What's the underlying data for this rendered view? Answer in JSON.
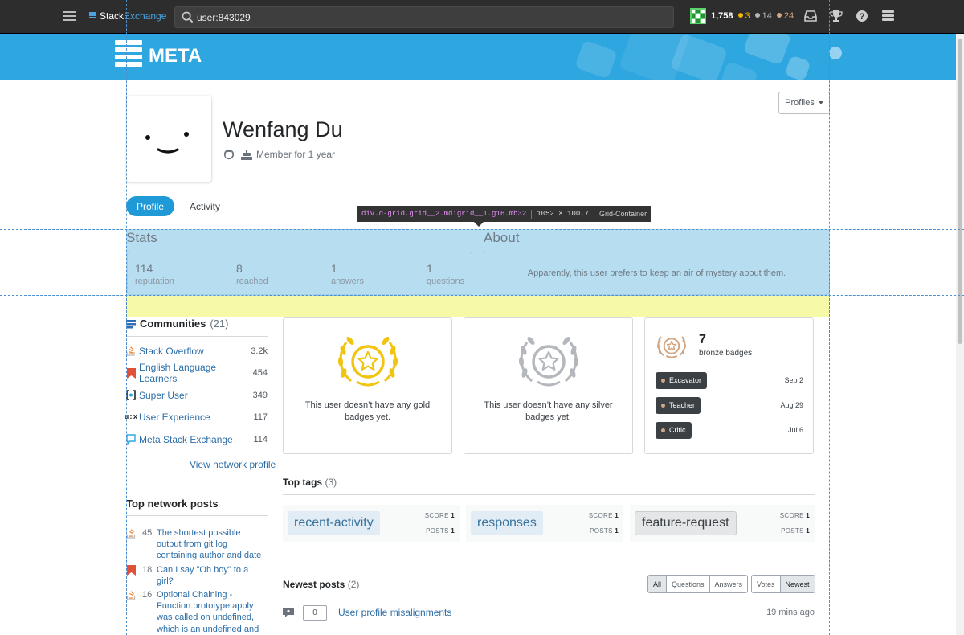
{
  "topbar": {
    "logo_primary": "Stack",
    "logo_secondary": "Exchange",
    "search_value": "user:843029",
    "reputation": "1,758",
    "gold": "3",
    "silver": "14",
    "bronze": "24"
  },
  "site": {
    "name": "META"
  },
  "devtools": {
    "selector": "div.d-grid.grid__2.md:grid__1.g16.mb32",
    "size": "1052 × 100.7",
    "kind": "Grid-Container"
  },
  "profile": {
    "name": "Wenfang Du",
    "member_for": "Member for 1 year",
    "profiles_button": "Profiles",
    "tabs": [
      {
        "label": "Profile"
      },
      {
        "label": "Activity"
      }
    ]
  },
  "stats": {
    "heading": "Stats",
    "items": [
      {
        "value": "114",
        "label": "reputation"
      },
      {
        "value": "8",
        "label": "reached"
      },
      {
        "value": "1",
        "label": "answers"
      },
      {
        "value": "1",
        "label": "questions"
      }
    ]
  },
  "about": {
    "heading": "About",
    "text": "Apparently, this user prefers to keep an air of mystery about them."
  },
  "communities": {
    "heading": "Communities",
    "count": "(21)",
    "items": [
      {
        "name": "Stack Overflow",
        "rep": "3.2k",
        "icon": "stack-overflow-icon",
        "color": "#f48024"
      },
      {
        "name": "English Language Learners",
        "rep": "454",
        "icon": "ell-icon",
        "color": "#e0513b"
      },
      {
        "name": "Super User",
        "rep": "349",
        "icon": "super-user-icon",
        "color": "#2f4d80"
      },
      {
        "name": "User Experience",
        "rep": "117",
        "icon": "ux-icon",
        "color": "#232629"
      },
      {
        "name": "Meta Stack Exchange",
        "rep": "114",
        "icon": "meta-icon",
        "color": "#2ea7e0"
      }
    ],
    "view_network": "View network profile"
  },
  "top_network_posts": {
    "heading": "Top network posts",
    "items": [
      {
        "score": "45",
        "title": "The shortest possible output from git log containing author and date"
      },
      {
        "score": "18",
        "title": "Can I say \"Oh boy\" to a girl?"
      },
      {
        "score": "16",
        "title": "Optional Chaining - Function.prototype.apply was called on undefined, which is an undefined and"
      }
    ]
  },
  "badges": {
    "gold_text": "This user doesn’t have any gold badges yet.",
    "silver_text": "This user doesn’t have any silver badges yet.",
    "bronze_count": "7",
    "bronze_label": "bronze badges",
    "bronze_items": [
      {
        "name": "Excavator",
        "date": "Sep 2"
      },
      {
        "name": "Teacher",
        "date": "Aug 29"
      },
      {
        "name": "Critic",
        "date": "Jul 6"
      }
    ],
    "colors": {
      "gold": "#f1c40f",
      "silver": "#b4b8bc",
      "bronze": "#d1a684"
    }
  },
  "top_tags": {
    "heading": "Top tags",
    "count": "(3)",
    "score_label": "SCORE",
    "posts_label": "POSTS",
    "items": [
      {
        "name": "recent-activity",
        "score": "1",
        "posts": "1"
      },
      {
        "name": "responses",
        "score": "1",
        "posts": "1"
      },
      {
        "name": "feature-request",
        "score": "1",
        "posts": "1"
      }
    ]
  },
  "newest_posts": {
    "heading": "Newest posts",
    "count": "(2)",
    "filters_type": [
      "All",
      "Questions",
      "Answers"
    ],
    "filters_sort": [
      "Votes",
      "Newest"
    ],
    "items": [
      {
        "votes": "0",
        "title": "User profile misalignments",
        "time": "19 mins ago"
      }
    ]
  }
}
